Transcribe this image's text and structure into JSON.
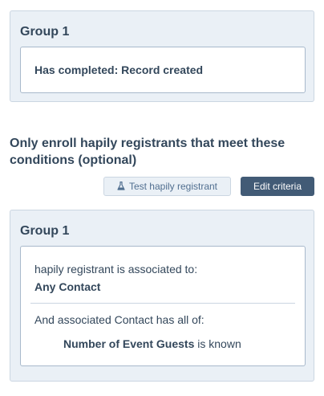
{
  "group1": {
    "title": "Group 1",
    "criteria": "Has completed: Record created"
  },
  "conditions": {
    "heading": "Only enroll hapily registrants that meet these conditions (optional)",
    "test_button_label": "Test hapily registrant",
    "test_button_icon": "flask-icon",
    "edit_button_label": "Edit criteria"
  },
  "group2": {
    "title": "Group 1",
    "association_text": "hapily registrant is associated to:",
    "association_value": "Any Contact",
    "all_of_text": "And associated Contact has all of:",
    "property_name": "Number of Event Guests",
    "property_operator": "is known"
  },
  "colors": {
    "panel_bg": "#eaf0f6",
    "panel_border": "#cbd6e2",
    "text": "#33475b",
    "primary_button": "#425b76"
  }
}
